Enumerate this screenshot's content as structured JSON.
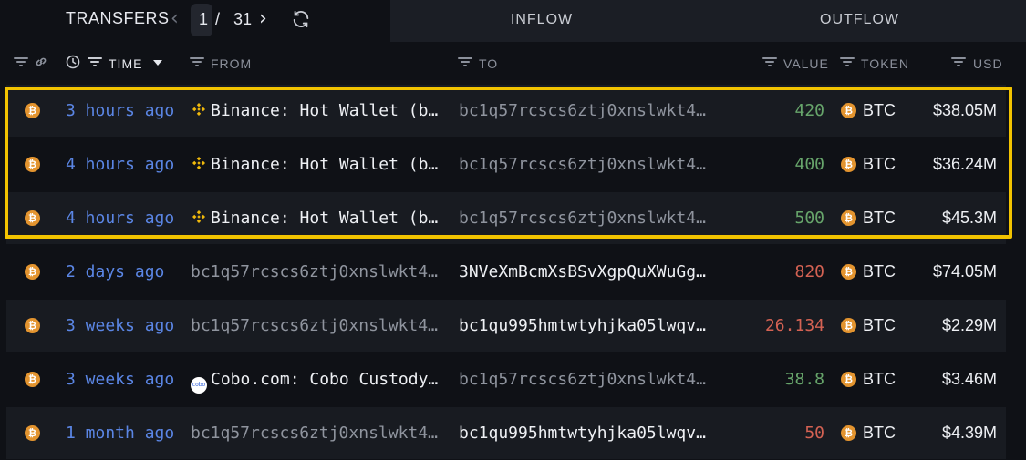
{
  "topbar": {
    "title": "TRANSFERS",
    "page_current": "1",
    "page_separator": "/",
    "page_total": "31",
    "tab_inflow": "INFLOW",
    "tab_outflow": "OUTFLOW"
  },
  "headers": {
    "time": "TIME",
    "from": "FROM",
    "to": "TO",
    "value": "VALUE",
    "token": "TOKEN",
    "usd": "USD"
  },
  "colors": {
    "highlight": "#f2c300",
    "time_link": "#5b86e5",
    "value_in": "#67a56b",
    "value_out": "#d46253",
    "btc": "#e3942f",
    "binance": "#f0b90b"
  },
  "rows": [
    {
      "time": "3 hours ago",
      "from": "Binance: Hot Wallet (b…",
      "from_icon": "binance-icon",
      "to": "bc1q57rcscs6ztj0xnslwkt4…",
      "value": "420",
      "direction": "in",
      "token": "BTC",
      "usd": "$38.05M"
    },
    {
      "time": "4 hours ago",
      "from": "Binance: Hot Wallet (b…",
      "from_icon": "binance-icon",
      "to": "bc1q57rcscs6ztj0xnslwkt4…",
      "value": "400",
      "direction": "in",
      "token": "BTC",
      "usd": "$36.24M"
    },
    {
      "time": "4 hours ago",
      "from": "Binance: Hot Wallet (b…",
      "from_icon": "binance-icon",
      "to": "bc1q57rcscs6ztj0xnslwkt4…",
      "value": "500",
      "direction": "in",
      "token": "BTC",
      "usd": "$45.3M"
    },
    {
      "time": "2 days ago",
      "from": "bc1q57rcscs6ztj0xnslwkt4…",
      "from_icon": "",
      "to": "3NVeXmBcmXsBSvXgpQuXWuGg…",
      "value": "820",
      "direction": "out",
      "token": "BTC",
      "usd": "$74.05M"
    },
    {
      "time": "3 weeks ago",
      "from": "bc1q57rcscs6ztj0xnslwkt4…",
      "from_icon": "",
      "to": "bc1qu995hmtwtyhjka05lwqv…",
      "value": "26.134",
      "direction": "out",
      "token": "BTC",
      "usd": "$2.29M"
    },
    {
      "time": "3 weeks ago",
      "from": "Cobo.com: Cobo Custody…",
      "from_icon": "cobo-icon",
      "to": "bc1q57rcscs6ztj0xnslwkt4…",
      "value": "38.8",
      "direction": "in",
      "token": "BTC",
      "usd": "$3.46M"
    },
    {
      "time": "1 month ago",
      "from": "bc1q57rcscs6ztj0xnslwkt4…",
      "from_icon": "",
      "to": "bc1qu995hmtwtyhjka05lwqv…",
      "value": "50",
      "direction": "out",
      "token": "BTC",
      "usd": "$4.39M"
    }
  ]
}
